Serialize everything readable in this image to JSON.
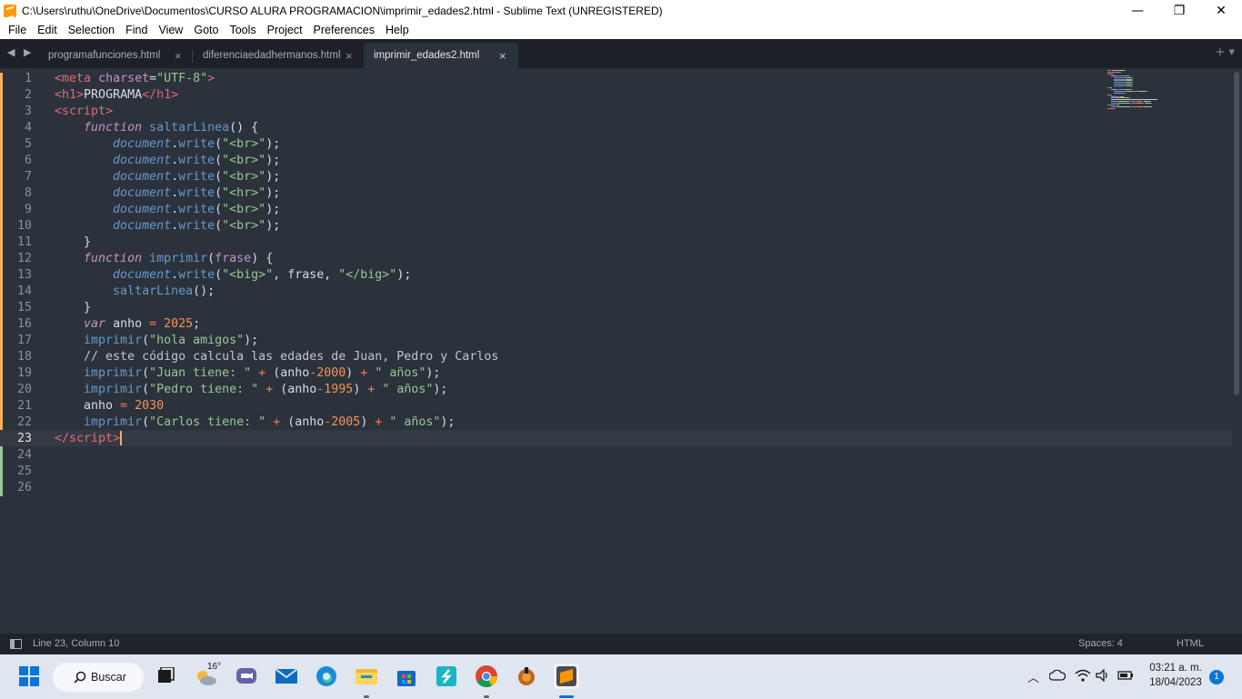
{
  "window": {
    "title": "C:\\Users\\ruthu\\OneDrive\\Documentos\\CURSO ALURA PROGRAMACION\\imprimir_edades2.html - Sublime Text (UNREGISTERED)",
    "minimize": "—",
    "restore": "❐",
    "close": "✕"
  },
  "menu": [
    "File",
    "Edit",
    "Selection",
    "Find",
    "View",
    "Goto",
    "Tools",
    "Project",
    "Preferences",
    "Help"
  ],
  "tabs": [
    {
      "label": "programafunciones.html",
      "close": "×"
    },
    {
      "label": "diferenciaedadhermanos.html",
      "close": "×"
    },
    {
      "label": "imprimir_edades2.html",
      "close": "×",
      "active": true
    }
  ],
  "tabbar": {
    "nav": "◀ ▶",
    "right": "+ ▾"
  },
  "editor": {
    "current_line": 23,
    "lines": [
      {
        "n": "1",
        "tokens": [
          [
            "tag",
            "<"
          ],
          [
            "tag",
            "meta"
          ],
          [
            "text",
            " "
          ],
          [
            "attr",
            "charset"
          ],
          [
            "text",
            "="
          ],
          [
            "str",
            "\"UTF-8\""
          ],
          [
            "tag",
            ">"
          ]
        ]
      },
      {
        "n": "2",
        "tokens": [
          [
            "tag",
            "<"
          ],
          [
            "tag",
            "h1"
          ],
          [
            "tag",
            ">"
          ],
          [
            "text",
            "PROGRAMA"
          ],
          [
            "tag",
            "</"
          ],
          [
            "tag",
            "h1"
          ],
          [
            "tag",
            ">"
          ]
        ]
      },
      {
        "n": "3",
        "tokens": [
          [
            "tag",
            "<"
          ],
          [
            "tag",
            "script"
          ],
          [
            "tag",
            ">"
          ]
        ]
      },
      {
        "n": "4",
        "tokens": [
          [
            "text",
            "    "
          ],
          [
            "kw",
            "function"
          ],
          [
            "text",
            " "
          ],
          [
            "fn",
            "saltarLinea"
          ],
          [
            "text",
            "() {"
          ]
        ]
      },
      {
        "n": "5",
        "tokens": [
          [
            "text",
            "        "
          ],
          [
            "obj",
            "document"
          ],
          [
            "text",
            "."
          ],
          [
            "fn",
            "write"
          ],
          [
            "text",
            "("
          ],
          [
            "str",
            "\"<br>\""
          ],
          [
            "text",
            ");"
          ]
        ]
      },
      {
        "n": "6",
        "tokens": [
          [
            "text",
            "        "
          ],
          [
            "obj",
            "document"
          ],
          [
            "text",
            "."
          ],
          [
            "fn",
            "write"
          ],
          [
            "text",
            "("
          ],
          [
            "str",
            "\"<br>\""
          ],
          [
            "text",
            ");"
          ]
        ]
      },
      {
        "n": "7",
        "tokens": [
          [
            "text",
            "        "
          ],
          [
            "obj",
            "document"
          ],
          [
            "text",
            "."
          ],
          [
            "fn",
            "write"
          ],
          [
            "text",
            "("
          ],
          [
            "str",
            "\"<br>\""
          ],
          [
            "text",
            ");"
          ]
        ]
      },
      {
        "n": "8",
        "tokens": [
          [
            "text",
            "        "
          ],
          [
            "obj",
            "document"
          ],
          [
            "text",
            "."
          ],
          [
            "fn",
            "write"
          ],
          [
            "text",
            "("
          ],
          [
            "str",
            "\"<hr>\""
          ],
          [
            "text",
            ");"
          ]
        ]
      },
      {
        "n": "9",
        "tokens": [
          [
            "text",
            "        "
          ],
          [
            "obj",
            "document"
          ],
          [
            "text",
            "."
          ],
          [
            "fn",
            "write"
          ],
          [
            "text",
            "("
          ],
          [
            "str",
            "\"<br>\""
          ],
          [
            "text",
            ");"
          ]
        ]
      },
      {
        "n": "10",
        "tokens": [
          [
            "text",
            "        "
          ],
          [
            "obj",
            "document"
          ],
          [
            "text",
            "."
          ],
          [
            "fn",
            "write"
          ],
          [
            "text",
            "("
          ],
          [
            "str",
            "\"<br>\""
          ],
          [
            "text",
            ");"
          ]
        ]
      },
      {
        "n": "11",
        "tokens": [
          [
            "text",
            "    }"
          ]
        ]
      },
      {
        "n": "12",
        "tokens": [
          [
            "text",
            "    "
          ],
          [
            "kw",
            "function"
          ],
          [
            "text",
            " "
          ],
          [
            "fn",
            "imprimir"
          ],
          [
            "text",
            "("
          ],
          [
            "attr",
            "frase"
          ],
          [
            "text",
            ") {"
          ]
        ]
      },
      {
        "n": "13",
        "tokens": [
          [
            "text",
            "        "
          ],
          [
            "obj",
            "document"
          ],
          [
            "text",
            "."
          ],
          [
            "fn",
            "write"
          ],
          [
            "text",
            "("
          ],
          [
            "str",
            "\"<big>\""
          ],
          [
            "text",
            ", frase, "
          ],
          [
            "str",
            "\"</big>\""
          ],
          [
            "text",
            ");"
          ]
        ]
      },
      {
        "n": "14",
        "tokens": [
          [
            "text",
            "        "
          ],
          [
            "fn",
            "saltarLinea"
          ],
          [
            "text",
            "();"
          ]
        ]
      },
      {
        "n": "15",
        "tokens": [
          [
            "text",
            "    }"
          ]
        ]
      },
      {
        "n": "16",
        "tokens": [
          [
            "text",
            "    "
          ],
          [
            "kw",
            "var"
          ],
          [
            "text",
            " anho "
          ],
          [
            "op",
            "="
          ],
          [
            "text",
            " "
          ],
          [
            "num",
            "2025"
          ],
          [
            "text",
            ";"
          ]
        ]
      },
      {
        "n": "17",
        "tokens": [
          [
            "text",
            "    "
          ],
          [
            "fn",
            "imprimir"
          ],
          [
            "text",
            "("
          ],
          [
            "str",
            "\"hola amigos\""
          ],
          [
            "text",
            ");"
          ]
        ]
      },
      {
        "n": "18",
        "tokens": [
          [
            "text",
            "    "
          ],
          [
            "cm",
            "// este código calcula las edades de Juan, Pedro y Carlos"
          ]
        ]
      },
      {
        "n": "19",
        "tokens": [
          [
            "text",
            "    "
          ],
          [
            "fn",
            "imprimir"
          ],
          [
            "text",
            "("
          ],
          [
            "str",
            "\"Juan tiene: \""
          ],
          [
            "text",
            " "
          ],
          [
            "op",
            "+"
          ],
          [
            "text",
            " (anho"
          ],
          [
            "op",
            "-"
          ],
          [
            "num",
            "2000"
          ],
          [
            "text",
            ") "
          ],
          [
            "op",
            "+"
          ],
          [
            "text",
            " "
          ],
          [
            "str",
            "\" años\""
          ],
          [
            "text",
            ");"
          ]
        ]
      },
      {
        "n": "20",
        "tokens": [
          [
            "text",
            "    "
          ],
          [
            "fn",
            "imprimir"
          ],
          [
            "text",
            "("
          ],
          [
            "str",
            "\"Pedro tiene: \""
          ],
          [
            "text",
            " "
          ],
          [
            "op",
            "+"
          ],
          [
            "text",
            " (anho"
          ],
          [
            "op",
            "-"
          ],
          [
            "num",
            "1995"
          ],
          [
            "text",
            ") "
          ],
          [
            "op",
            "+"
          ],
          [
            "text",
            " "
          ],
          [
            "str",
            "\" años\""
          ],
          [
            "text",
            ");"
          ]
        ]
      },
      {
        "n": "21",
        "tokens": [
          [
            "text",
            "    anho "
          ],
          [
            "op",
            "="
          ],
          [
            "text",
            " "
          ],
          [
            "num",
            "2030"
          ]
        ]
      },
      {
        "n": "22",
        "tokens": [
          [
            "text",
            "    "
          ],
          [
            "fn",
            "imprimir"
          ],
          [
            "text",
            "("
          ],
          [
            "str",
            "\"Carlos tiene: \""
          ],
          [
            "text",
            " "
          ],
          [
            "op",
            "+"
          ],
          [
            "text",
            " (anho"
          ],
          [
            "op",
            "-"
          ],
          [
            "num",
            "2005"
          ],
          [
            "text",
            ") "
          ],
          [
            "op",
            "+"
          ],
          [
            "text",
            " "
          ],
          [
            "str",
            "\" años\""
          ],
          [
            "text",
            ");"
          ]
        ]
      },
      {
        "n": "23",
        "tokens": [
          [
            "tag",
            "</"
          ],
          [
            "tag",
            "script"
          ],
          [
            "tag",
            ">"
          ]
        ]
      },
      {
        "n": "24",
        "tokens": []
      },
      {
        "n": "25",
        "tokens": []
      },
      {
        "n": "26",
        "tokens": []
      }
    ],
    "modified_color": "#f9ae58",
    "added_color": "#99c794"
  },
  "status": {
    "position": "Line 23, Column 10",
    "indent": "Spaces: 4",
    "syntax": "HTML"
  },
  "taskbar": {
    "search_label": "Buscar",
    "weather_temp": "16°",
    "time": "03:21 a. m.",
    "date": "18/04/2023",
    "notifications": "1",
    "apps": [
      "start-icon",
      "task-view-icon",
      "weather-icon",
      "chat-icon",
      "mail-icon",
      "edge-icon",
      "file-explorer-icon",
      "store-icon",
      "app-s-icon",
      "chrome-icon",
      "game-icon",
      "sublime-text-icon"
    ]
  }
}
